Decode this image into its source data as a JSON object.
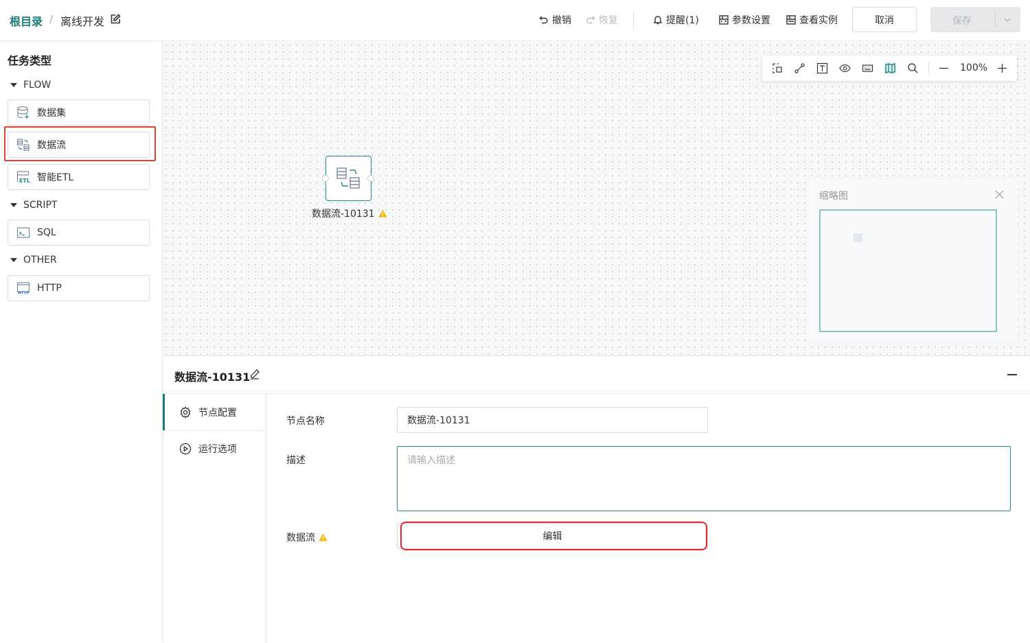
{
  "breadcrumb": {
    "root": "根目录",
    "separator": "/",
    "current": "离线开发"
  },
  "toolbar": {
    "undo": "撤销",
    "redo": "恢复",
    "remind": "提醒(1)",
    "params": "参数设置",
    "instances": "查看实例",
    "cancel": "取消",
    "save": "保存"
  },
  "sidebar": {
    "title": "任务类型",
    "groups": [
      {
        "label": "FLOW",
        "items": [
          {
            "label": "数据集"
          },
          {
            "label": "数据流"
          },
          {
            "label": "智能ETL"
          }
        ]
      },
      {
        "label": "SCRIPT",
        "items": [
          {
            "label": "SQL"
          }
        ]
      },
      {
        "label": "OTHER",
        "items": [
          {
            "label": "HTTP"
          }
        ]
      }
    ],
    "highlighted_item": "数据流"
  },
  "canvas": {
    "zoom": "100%",
    "node": {
      "label": "数据流-10131",
      "warning": true
    },
    "minimap": {
      "title": "缩略图"
    }
  },
  "panel": {
    "title": "数据流-10131",
    "nav": [
      {
        "label": "节点配置"
      },
      {
        "label": "运行选项"
      }
    ],
    "active_nav": "节点配置",
    "fields": {
      "name_label": "节点名称",
      "name_value": "数据流-10131",
      "desc_label": "描述",
      "desc_placeholder": "请输入描述",
      "flow_label": "数据流",
      "flow_button": "编辑"
    }
  },
  "colors": {
    "accent": "#1b7a7a",
    "highlight": "#e0402f",
    "warning": "#f5b800"
  }
}
